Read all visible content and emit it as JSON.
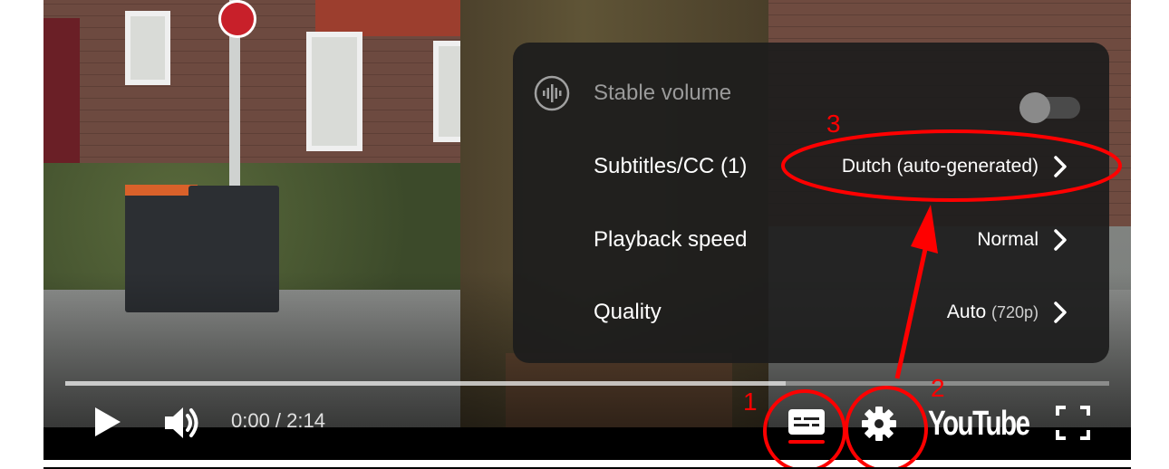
{
  "menu": {
    "items": [
      {
        "label": "Stable volume",
        "value": "",
        "icon": "stable-volume-icon",
        "toggle": "off",
        "enabled": false
      },
      {
        "label": "Subtitles/CC (1)",
        "value": "Dutch (auto-generated)",
        "value_sub": ""
      },
      {
        "label": "Playback speed",
        "value": "Normal",
        "value_sub": ""
      },
      {
        "label": "Quality",
        "value": "Auto",
        "value_sub": "(720p)"
      }
    ]
  },
  "player": {
    "time": "0:00 / 2:14",
    "brand": "YouTube",
    "progress_loaded_fraction": 0.69
  },
  "annotations": {
    "marker_1": "1",
    "marker_2": "2",
    "marker_3": "3",
    "color": "#ff0000"
  },
  "colors": {
    "menu_bg": "#1c1c1c",
    "subtitle_underline": "#ff0000"
  }
}
